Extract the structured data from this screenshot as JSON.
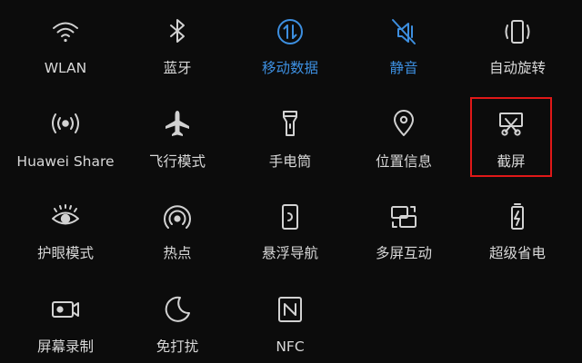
{
  "theme": {
    "active_color": "#3d8fe0",
    "highlight_color": "#e01818"
  },
  "tiles": [
    {
      "label": "WLAN",
      "icon": "wifi-icon",
      "active": false
    },
    {
      "label": "蓝牙",
      "icon": "bluetooth-icon",
      "active": false
    },
    {
      "label": "移动数据",
      "icon": "mobile-data-icon",
      "active": true
    },
    {
      "label": "静音",
      "icon": "mute-icon",
      "active": true
    },
    {
      "label": "自动旋转",
      "icon": "auto-rotate-icon",
      "active": false
    },
    {
      "label": "Huawei Share",
      "icon": "huawei-share-icon",
      "active": false
    },
    {
      "label": "飞行模式",
      "icon": "airplane-icon",
      "active": false
    },
    {
      "label": "手电筒",
      "icon": "flashlight-icon",
      "active": false
    },
    {
      "label": "位置信息",
      "icon": "location-icon",
      "active": false
    },
    {
      "label": "截屏",
      "icon": "screenshot-icon",
      "active": false,
      "highlighted": true
    },
    {
      "label": "护眼模式",
      "icon": "eye-comfort-icon",
      "active": false
    },
    {
      "label": "热点",
      "icon": "hotspot-icon",
      "active": false
    },
    {
      "label": "悬浮导航",
      "icon": "floating-nav-icon",
      "active": false
    },
    {
      "label": "多屏互动",
      "icon": "multi-screen-icon",
      "active": false
    },
    {
      "label": "超级省电",
      "icon": "battery-saver-icon",
      "active": false
    },
    {
      "label": "屏幕录制",
      "icon": "screen-record-icon",
      "active": false
    },
    {
      "label": "免打扰",
      "icon": "do-not-disturb-icon",
      "active": false
    },
    {
      "label": "NFC",
      "icon": "nfc-icon",
      "active": false
    }
  ]
}
